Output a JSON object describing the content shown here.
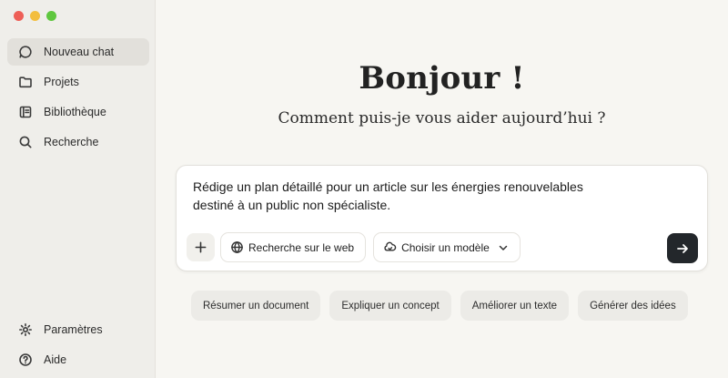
{
  "window": {
    "controls": [
      "close",
      "minimize",
      "zoom"
    ]
  },
  "sidebar": {
    "items": [
      {
        "label": "Nouveau chat",
        "icon": "new-chat-icon",
        "active": true
      },
      {
        "label": "Projets",
        "icon": "folder-icon",
        "active": false
      },
      {
        "label": "Bibliothèque",
        "icon": "library-icon",
        "active": false
      },
      {
        "label": "Recherche",
        "icon": "search-icon",
        "active": false
      }
    ],
    "bottom_items": [
      {
        "label": "Paramètres",
        "icon": "gear-icon"
      },
      {
        "label": "Aide",
        "icon": "help-icon"
      }
    ]
  },
  "main": {
    "greeting": "Bonjour !",
    "subtitle": "Comment puis-je vous aider aujourd’hui ?",
    "composer": {
      "text_line1": "Rédige un plan détaillé pour un article sur les énergies renouvelables",
      "text_line2": "destiné à un public non spécialiste.",
      "web_search_label": "Recherche sur le web",
      "model_label": "Choisir un modèle"
    },
    "suggestions": [
      "Résumer un document",
      "Expliquer un concept",
      "Améliorer un texte",
      "Générer des idées"
    ]
  },
  "colors": {
    "background": "#f7f6f2",
    "sidebar": "#efeeea",
    "send_button": "#23272b",
    "close": "#ee5f57",
    "minimize": "#f3be3f",
    "zoom": "#5fc73f"
  }
}
